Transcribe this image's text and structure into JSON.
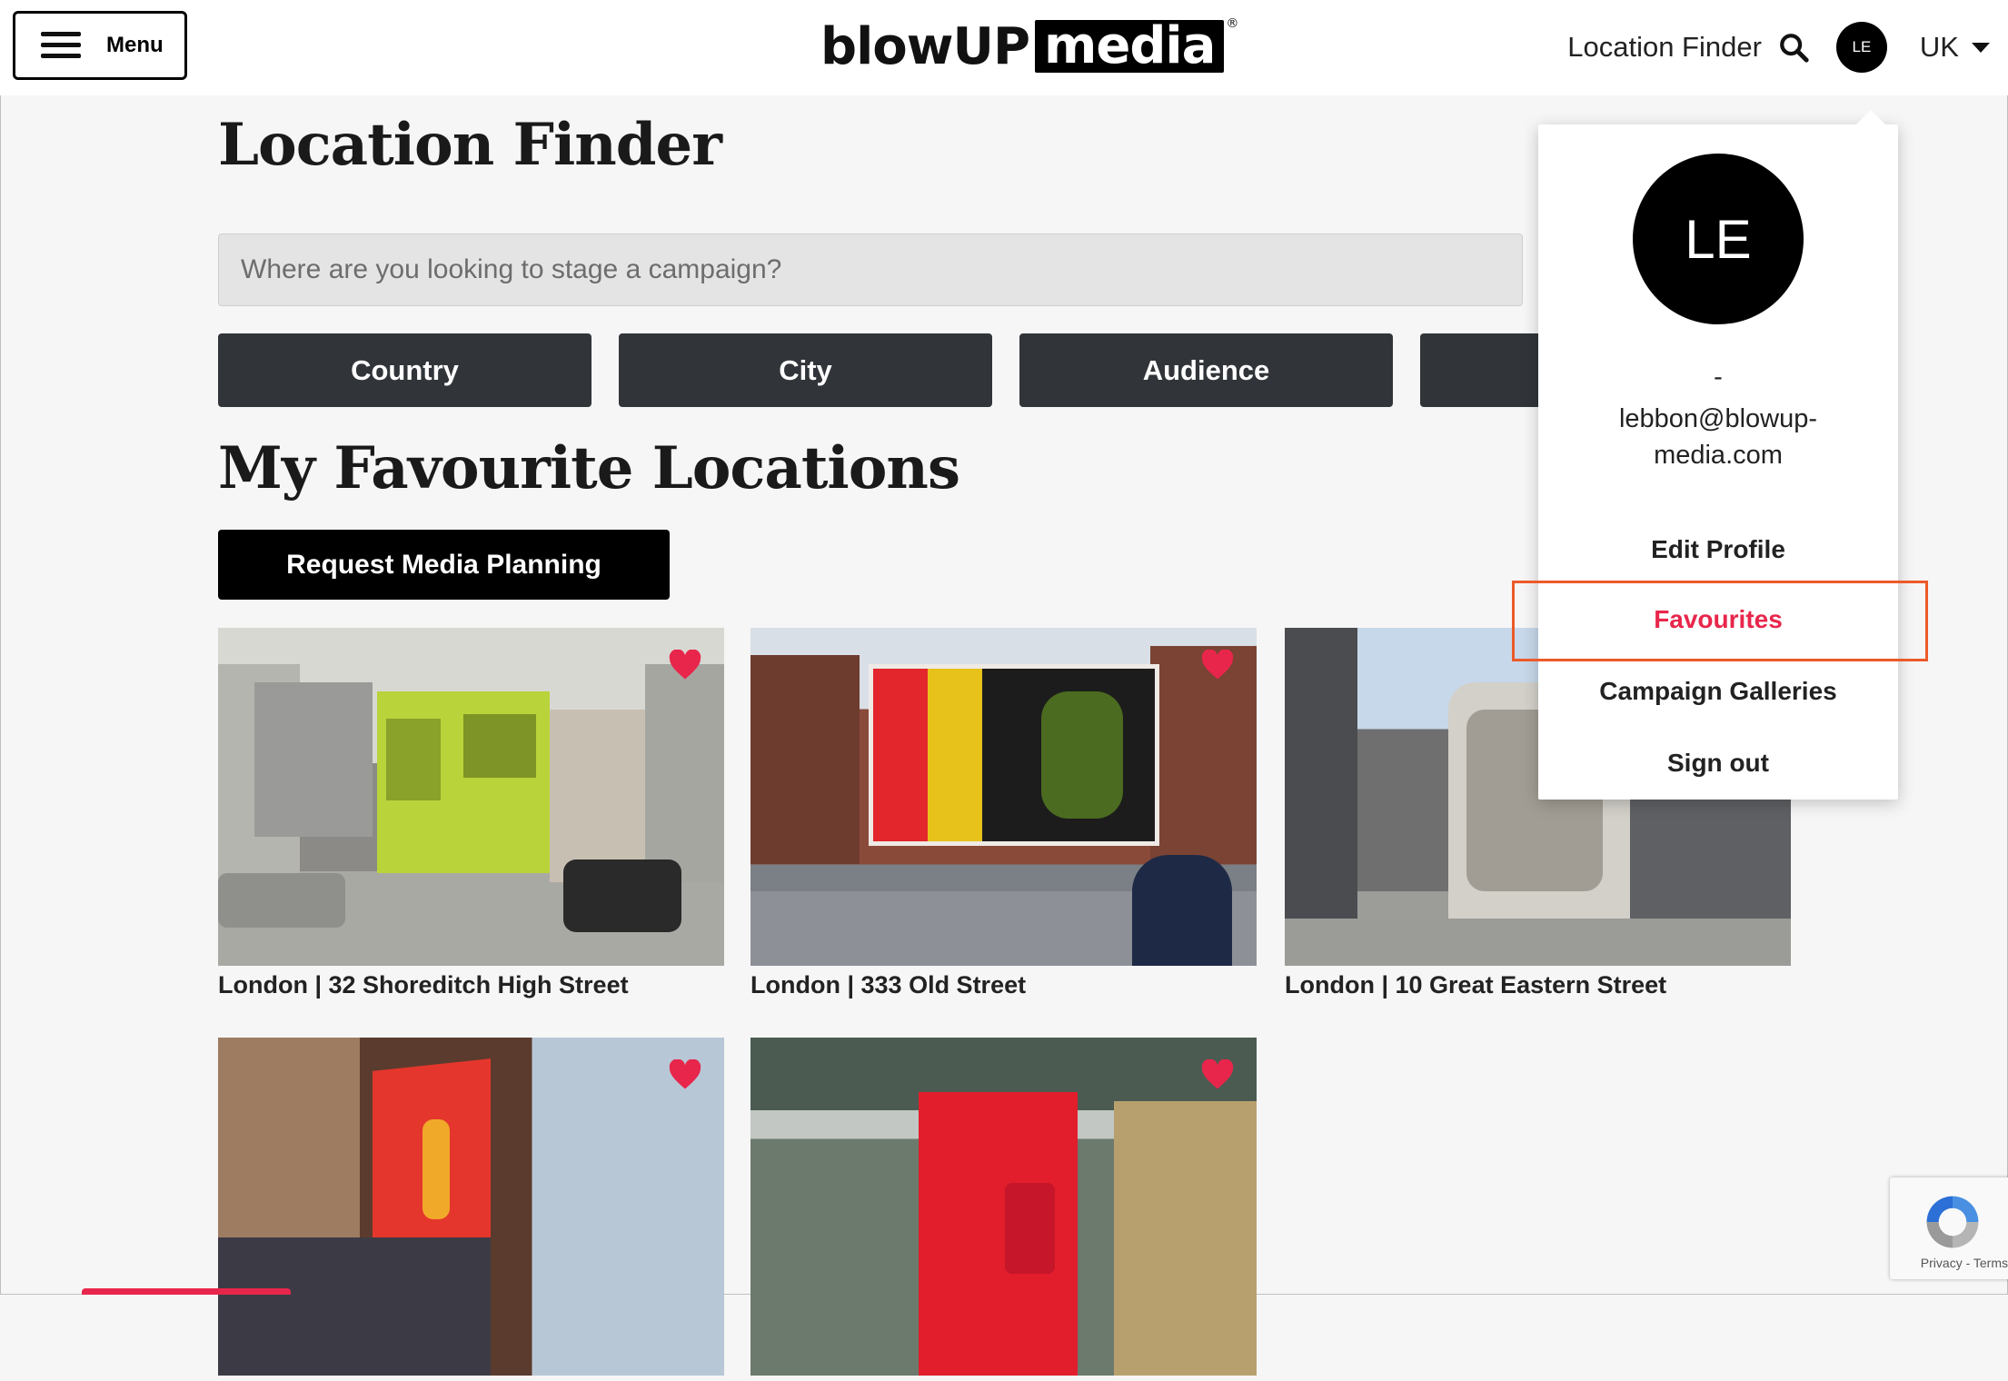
{
  "header": {
    "menu_label": "Menu",
    "logo_left": "blowUP",
    "logo_right": "media",
    "logo_mark": "®",
    "location_finder_link": "Location Finder",
    "avatar_initials": "LE",
    "region": "UK"
  },
  "main": {
    "title": "Location Finder",
    "search_placeholder": "Where are you looking to stage a campaign?",
    "filters": [
      "Country",
      "City",
      "Audience"
    ],
    "favourites_title": "My Favourite Locations",
    "request_button": "Request Media Planning",
    "cards": [
      {
        "caption": "London | 32 Shoreditch High Street"
      },
      {
        "caption": "London | 333 Old Street"
      },
      {
        "caption": "London | 10 Great Eastern Street"
      },
      {
        "caption": ""
      },
      {
        "caption": ""
      }
    ]
  },
  "dropdown": {
    "avatar_initials": "LE",
    "name": "-",
    "email": "lebbon@blowup-media.com",
    "items": [
      "Edit Profile",
      "Favourites",
      "Campaign Galleries",
      "Sign out"
    ]
  },
  "recaptcha": {
    "text": "Privacy - Terms"
  },
  "colors": {
    "accent": "#e8264b",
    "highlight": "#ec5a2a",
    "button_dark": "#31353a"
  }
}
